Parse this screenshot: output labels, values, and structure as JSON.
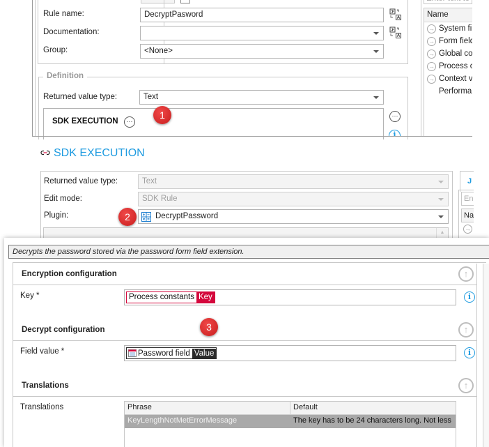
{
  "top_panel": {
    "rule_name_label": "Rule name:",
    "rule_name_value": "DecryptPasword",
    "documentation_label": "Documentation:",
    "documentation_value": "",
    "group_label": "Group:",
    "group_value": "<None>",
    "definition_legend": "Definition",
    "returned_value_type_label": "Returned value type:",
    "returned_value_type_value": "Text",
    "sdk_execution_block": "SDK EXECUTION",
    "badge": "1"
  },
  "side_panel_top": {
    "search_placeholder": "Enter text to",
    "column_header": "Name",
    "items": [
      {
        "label": "System fi",
        "icon": "arrow-circle-right"
      },
      {
        "label": "Form field",
        "icon": "arrow-circle-right"
      },
      {
        "label": "Global cor",
        "icon": "arrow-circle-right"
      },
      {
        "label": "Process c",
        "icon": "arrow-circle-right"
      },
      {
        "label": "Context v",
        "icon": "arrow-circle-right"
      },
      {
        "label": "Performan",
        "icon": ""
      }
    ]
  },
  "sdk_panel": {
    "title": "SDK EXECUTION",
    "returned_value_type_label": "Returned value type:",
    "returned_value_type_value": "Text",
    "edit_mode_label": "Edit mode:",
    "edit_mode_value": "SDK Rule",
    "plugin_label": "Plugin:",
    "plugin_value": "DecryptPassword",
    "badge": "2",
    "side_tab_label": "J",
    "side_search_placeholder": "En",
    "side_column_header": "Na"
  },
  "config_panel": {
    "description": "Decrypts the password stored via the password form field extension.",
    "badge": "3",
    "sections": {
      "encryption": {
        "title": "Encryption configuration",
        "key_label": "Key *",
        "key_token_source": "Process constants",
        "key_token_name": "Key",
        "key_token_color": "#d4073c"
      },
      "decrypt": {
        "title": "Decrypt configuration",
        "field_label": "Field value *",
        "field_token_source": "Password field",
        "field_token_name": "Value",
        "field_token_color": "#2b2b2b"
      },
      "translations": {
        "title": "Translations",
        "label": "Translations",
        "columns": [
          "Phrase",
          "Default"
        ],
        "rows": [
          {
            "phrase": "KeyLengthNotMetErrorMessage",
            "default": "The key has to be 24 characters long. Not less"
          }
        ]
      }
    }
  }
}
